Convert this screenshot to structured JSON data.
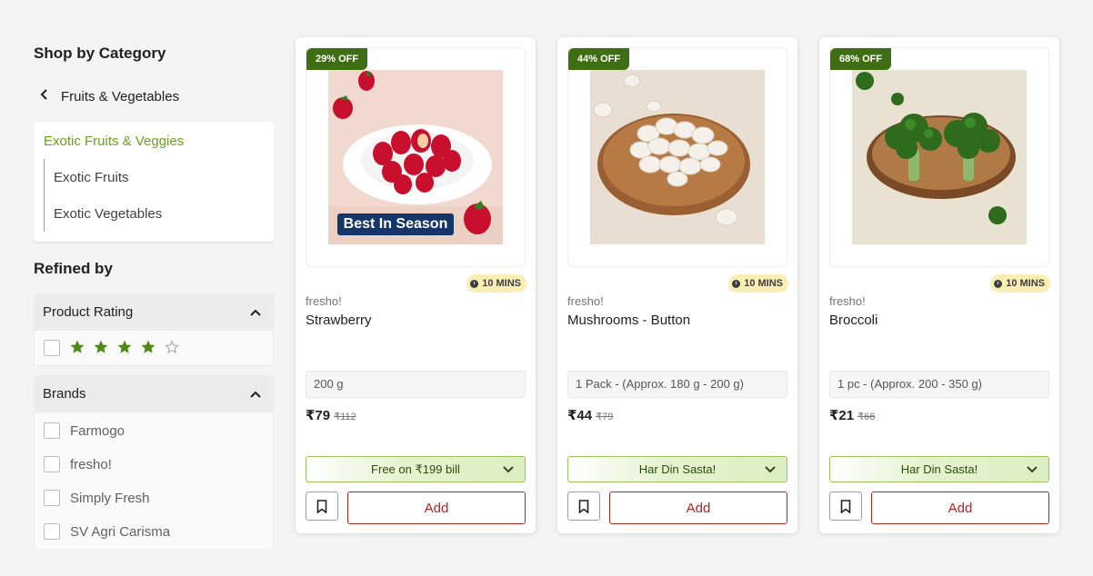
{
  "sidebar": {
    "category_heading": "Shop by Category",
    "back_label": "Fruits & Vegetables",
    "active_category": "Exotic Fruits & Veggies",
    "subcategories": [
      "Exotic Fruits",
      "Exotic Vegetables"
    ],
    "refined_heading": "Refined by",
    "filters": {
      "rating_label": "Product Rating",
      "rating_stars": 4,
      "brands_label": "Brands",
      "brands": [
        "Farmogo",
        "fresho!",
        "Simply Fresh",
        "SV Agri Carisma"
      ]
    }
  },
  "products": [
    {
      "discount": "29% OFF",
      "image_overlay": "Best In Season",
      "eta": "10 MINS",
      "brand": "fresho!",
      "name": "Strawberry",
      "pack": "200 g",
      "price": "₹79",
      "mrp": "₹112",
      "offer": "Free on ₹199 bill",
      "add_label": "Add"
    },
    {
      "discount": "44% OFF",
      "eta": "10 MINS",
      "brand": "fresho!",
      "name": "Mushrooms - Button",
      "pack": "1 Pack - (Approx. 180 g - 200 g)",
      "price": "₹44",
      "mrp": "₹79",
      "offer": "Har Din Sasta!",
      "add_label": "Add"
    },
    {
      "discount": "68% OFF",
      "eta": "10 MINS",
      "brand": "fresho!",
      "name": "Broccoli",
      "pack": "1 pc - (Approx. 200 - 350 g)",
      "price": "₹21",
      "mrp": "₹66",
      "offer": "Har Din Sasta!",
      "add_label": "Add"
    }
  ],
  "colors": {
    "accent_green": "#6aa21a",
    "badge_green": "#3f6d14",
    "add_red": "#b3261e",
    "eta_yellow": "#fbeeb5",
    "star_green": "#4e8a16"
  }
}
